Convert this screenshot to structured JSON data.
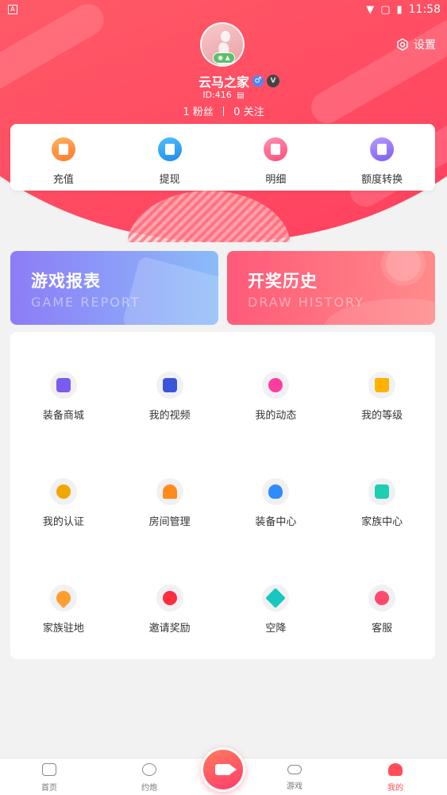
{
  "status_bar": {
    "time": "11:58"
  },
  "profile": {
    "settings_label": "设置",
    "username": "云马之家",
    "gender_symbol": "♂",
    "vip_symbol": "V",
    "user_id": "ID:416",
    "followers_count": "1",
    "followers_label": "粉丝",
    "following_count": "0",
    "following_label": "关注"
  },
  "wallet": {
    "items": [
      {
        "label": "充值",
        "icon": "wallet-icon",
        "color": "#ff8c3a"
      },
      {
        "label": "提现",
        "icon": "withdraw-icon",
        "color": "#1f9be8"
      },
      {
        "label": "明细",
        "icon": "details-icon",
        "color": "#ff5d84"
      },
      {
        "label": "额度转换",
        "icon": "transfer-icon",
        "color": "#8a6cf0"
      }
    ]
  },
  "banners": {
    "game_report": {
      "title": "游戏报表",
      "subtitle": "GAME REPORT"
    },
    "draw_history": {
      "title": "开奖历史",
      "subtitle": "DRAW HISTORY"
    }
  },
  "menu": {
    "items": [
      {
        "label": "装备商城",
        "icon": "shop-icon",
        "color": "#7b5cf0"
      },
      {
        "label": "我的视频",
        "icon": "video-icon",
        "color": "#3b55d9"
      },
      {
        "label": "我的动态",
        "icon": "moment-icon",
        "color": "#ff3da0"
      },
      {
        "label": "我的等级",
        "icon": "crown-icon",
        "color": "#ffb300"
      },
      {
        "label": "我的认证",
        "icon": "medal-icon",
        "color": "#f0a800"
      },
      {
        "label": "房间管理",
        "icon": "house-icon",
        "color": "#ff8c1a"
      },
      {
        "label": "装备中心",
        "icon": "bulb-icon",
        "color": "#2f8cff"
      },
      {
        "label": "家族中心",
        "icon": "grid-icon",
        "color": "#1ccfb0"
      },
      {
        "label": "家族驻地",
        "icon": "location-icon",
        "color": "#ff9d2e"
      },
      {
        "label": "邀请奖励",
        "icon": "heart-icon",
        "color": "#ff2d3d"
      },
      {
        "label": "空降",
        "icon": "plane-icon",
        "color": "#18c7c0"
      },
      {
        "label": "客服",
        "icon": "service-icon",
        "color": "#ff4a6e"
      }
    ]
  },
  "bottom_nav": {
    "items": [
      {
        "label": "首页",
        "icon": "home-icon"
      },
      {
        "label": "约炮",
        "icon": "heart-chat-icon"
      },
      {
        "label": "游戏",
        "icon": "gamepad-icon"
      },
      {
        "label": "我的",
        "icon": "user-icon"
      }
    ],
    "center_icon": "camera-icon"
  }
}
